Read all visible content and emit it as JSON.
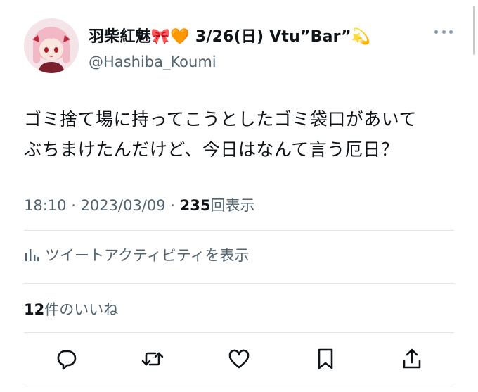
{
  "author": {
    "display_name": "羽柴紅魅🎀🧡 3/26(日) Vtu”Bar”💫",
    "handle": "@Hashiba_Koumi"
  },
  "tweet": {
    "line1": "ゴミ捨て場に持ってこうとしたゴミ袋口があいて",
    "line2": "ぶちまけたんだけど、今日はなんて言う厄日？"
  },
  "meta": {
    "time": "18:10",
    "sep1": " · ",
    "date": "2023/03/09",
    "sep2": " · ",
    "views_count": "235",
    "views_label": "回表示"
  },
  "activity": {
    "label": "ツイートアクティビティを表示",
    "icon": "bar-chart-icon"
  },
  "likes": {
    "count": "12",
    "label": "件のいいね"
  },
  "actions": [
    "reply-icon",
    "retweet-icon",
    "like-icon",
    "bookmark-icon",
    "share-icon"
  ],
  "colors": {
    "text": "#0f1419",
    "secondary": "#536471",
    "divider": "#e1e6ea",
    "avatar_bg": "#f6e7ea"
  }
}
